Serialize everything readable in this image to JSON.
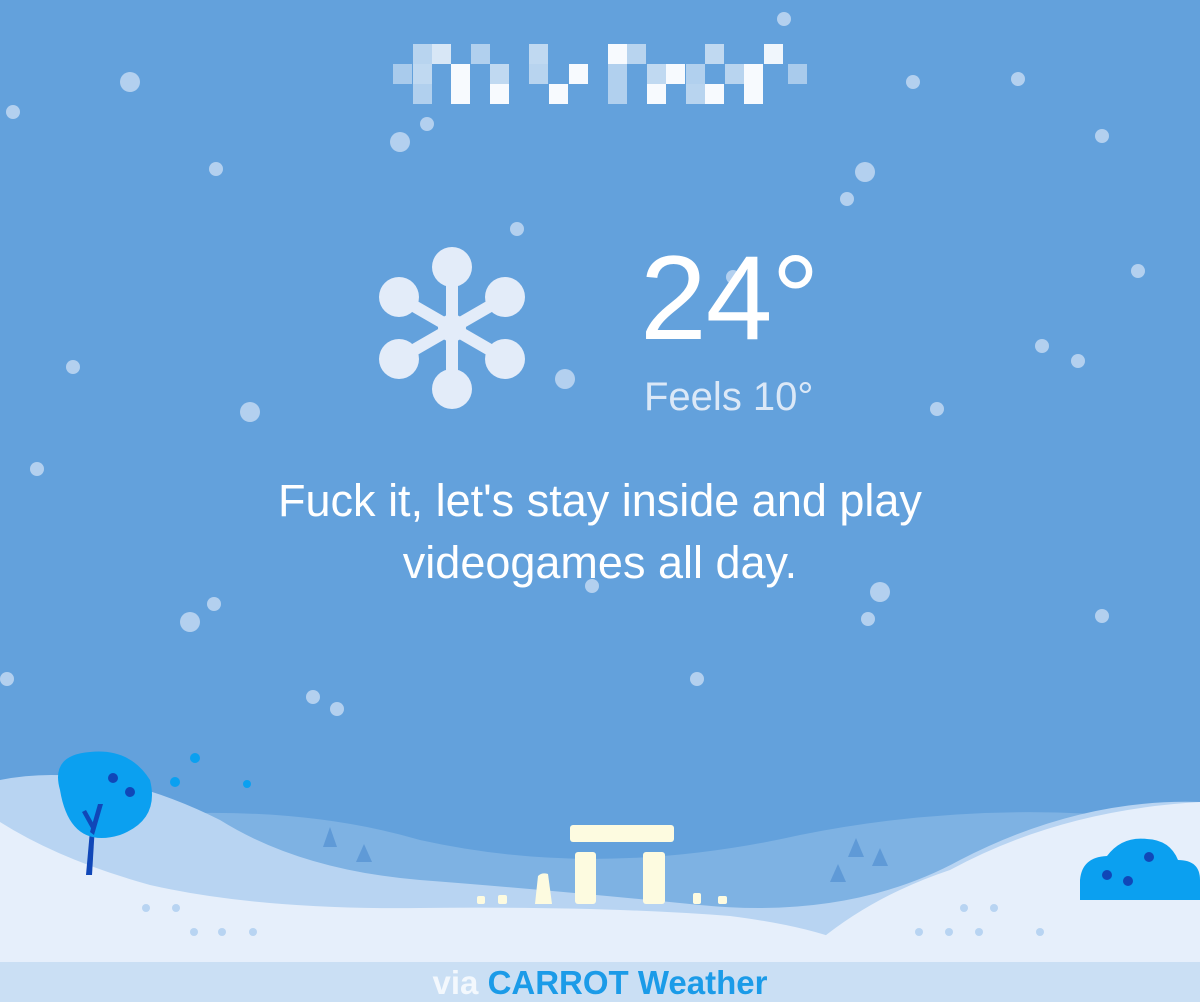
{
  "header": {
    "location_pixelated": true
  },
  "weather": {
    "condition_icon": "snowflake-icon",
    "temperature": "24°",
    "feels_like": "Feels 10°"
  },
  "message": {
    "line1": "Fuck it, let's stay inside and play",
    "line2": "videogames all day."
  },
  "footer": {
    "via": "via",
    "brand": "CARROT Weather"
  },
  "colors": {
    "sky": "#63a1dc",
    "snow_hill_light": "#e6effb",
    "snow_hill_mid": "#b8d4f2",
    "brand_blue": "#1b9be8",
    "tree_blue": "#0ba0f0",
    "stonehenge": "#fdfbe0"
  }
}
